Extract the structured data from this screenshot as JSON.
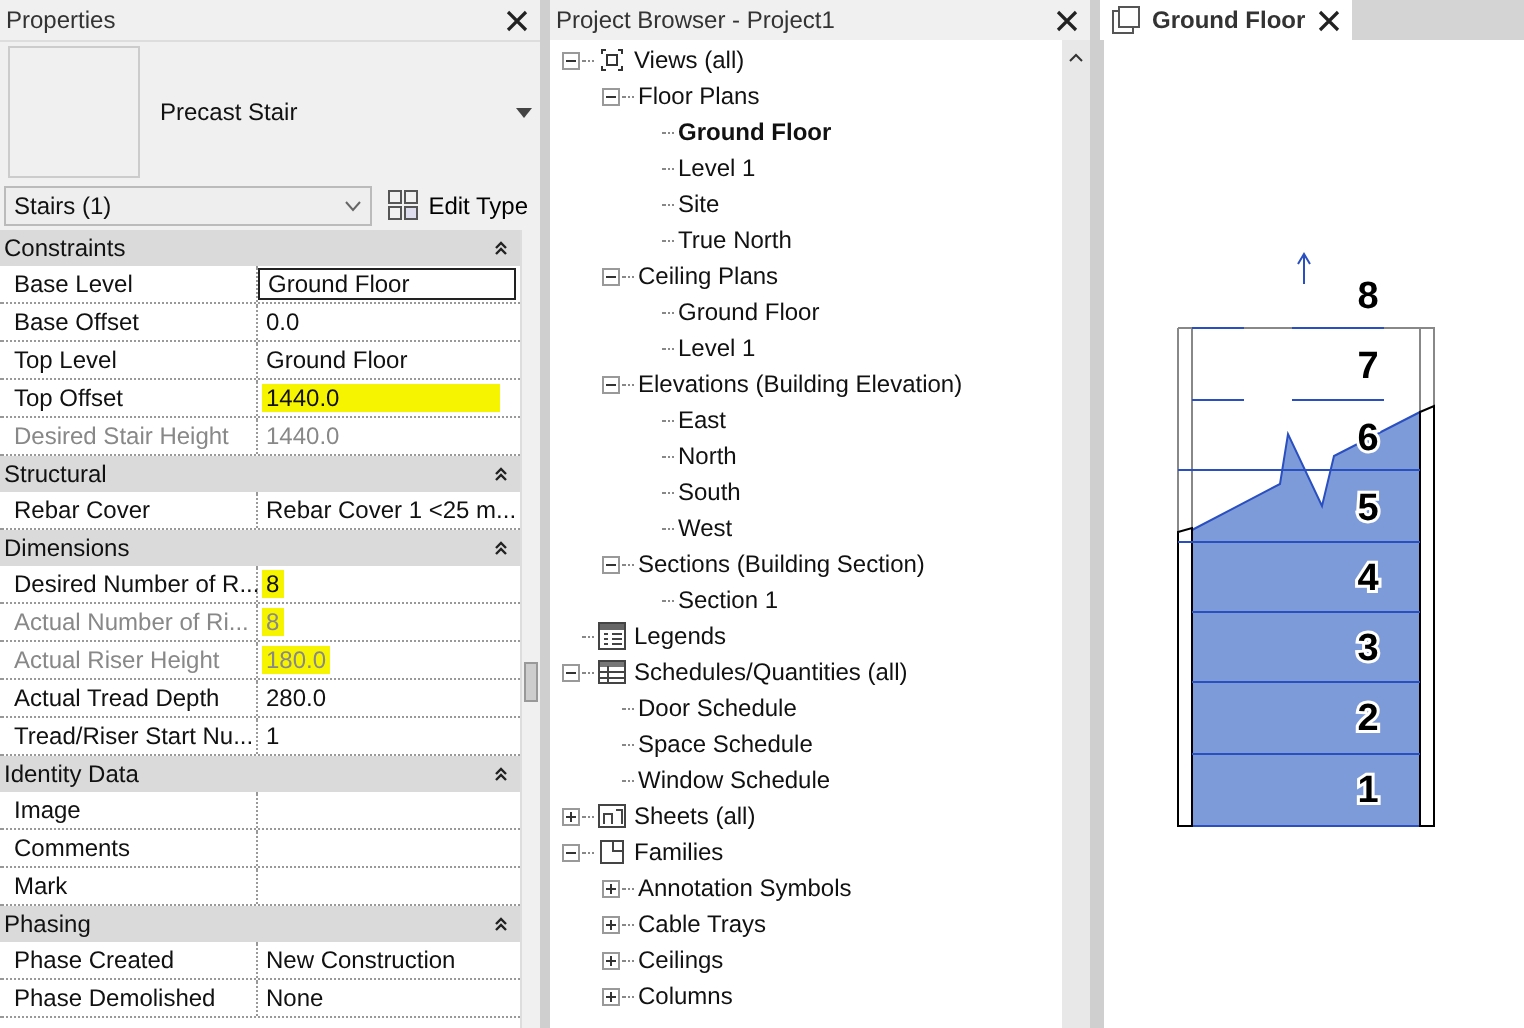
{
  "properties": {
    "title": "Properties",
    "type_name": "Precast Stair",
    "instance_selector": "Stairs (1)",
    "edit_type_button": "Edit Type",
    "groups": [
      {
        "name": "Constraints",
        "expanded": true,
        "rows": [
          {
            "label": "Base Level",
            "value": "Ground Floor",
            "disabled": false,
            "selected": true
          },
          {
            "label": "Base Offset",
            "value": "0.0",
            "disabled": false,
            "selected": false
          },
          {
            "label": "Top Level",
            "value": "Ground Floor",
            "disabled": false,
            "selected": false
          },
          {
            "label": "Top Offset",
            "value": "1440.0",
            "disabled": false,
            "highlighted": true,
            "selected": false
          },
          {
            "label": "Desired Stair Height",
            "value": "1440.0",
            "disabled": true,
            "selected": false
          }
        ]
      },
      {
        "name": "Structural",
        "expanded": true,
        "rows": [
          {
            "label": "Rebar Cover",
            "value": "Rebar Cover 1 <25 m...",
            "disabled": false,
            "selected": false
          }
        ]
      },
      {
        "name": "Dimensions",
        "expanded": true,
        "rows": [
          {
            "label": "Desired Number of R...",
            "value": "8",
            "disabled": false,
            "highlighted": true,
            "selected": false
          },
          {
            "label": "Actual Number of Ri...",
            "value": "8",
            "disabled": true,
            "highlighted": true,
            "selected": false
          },
          {
            "label": "Actual Riser Height",
            "value": "180.0",
            "disabled": true,
            "highlighted": true,
            "selected": false
          },
          {
            "label": "Actual Tread Depth",
            "value": "280.0",
            "disabled": false,
            "selected": false
          },
          {
            "label": "Tread/Riser Start Nu...",
            "value": "1",
            "disabled": false,
            "selected": false
          }
        ]
      },
      {
        "name": "Identity Data",
        "expanded": true,
        "rows": [
          {
            "label": "Image",
            "disabled": false,
            "selected": false
          },
          {
            "label": "Comments",
            "disabled": false,
            "selected": false
          },
          {
            "label": "Mark",
            "disabled": false,
            "selected": false
          }
        ]
      },
      {
        "name": "Phasing",
        "expanded": true,
        "rows": [
          {
            "label": "Phase Created",
            "value": "New Construction",
            "disabled": false,
            "selected": false
          },
          {
            "label": "Phase Demolished",
            "value": "None",
            "disabled": false,
            "selected": false
          }
        ]
      }
    ]
  },
  "project_browser": {
    "title": "Project Browser - Project1",
    "tree": [
      {
        "label": "Views (all)",
        "kind": "views",
        "expanded": true,
        "children": [
          {
            "label": "Floor Plans",
            "expanded": true,
            "children": [
              {
                "label": "Ground Floor",
                "active": true
              },
              {
                "label": "Level 1",
                "active": false
              },
              {
                "label": "Site",
                "active": false
              },
              {
                "label": "True North",
                "active": false
              }
            ]
          },
          {
            "label": "Ceiling Plans",
            "expanded": true,
            "children": [
              {
                "label": "Ground Floor",
                "active": false
              },
              {
                "label": "Level 1",
                "active": false
              }
            ]
          },
          {
            "label": "Elevations (Building Elevation)",
            "expanded": true,
            "children": [
              {
                "label": "East",
                "active": false
              },
              {
                "label": "North",
                "active": false
              },
              {
                "label": "South",
                "active": false
              },
              {
                "label": "West",
                "active": false
              }
            ]
          },
          {
            "label": "Sections (Building Section)",
            "expanded": true,
            "children": [
              {
                "label": "Section 1",
                "active": false
              }
            ]
          }
        ]
      },
      {
        "label": "Legends",
        "kind": "legends"
      },
      {
        "label": "Schedules/Quantities (all)",
        "kind": "schedules",
        "expanded": true,
        "children": [
          {
            "label": "Door Schedule"
          },
          {
            "label": "Space Schedule"
          },
          {
            "label": "Window Schedule"
          }
        ]
      },
      {
        "label": "Sheets (all)",
        "kind": "sheets",
        "expanded": false
      },
      {
        "label": "Families",
        "kind": "families",
        "expanded": true,
        "children": [
          {
            "label": "Annotation Symbols",
            "expanded": false
          },
          {
            "label": "Cable Trays",
            "expanded": false
          },
          {
            "label": "Ceilings",
            "expanded": false
          },
          {
            "label": "Columns",
            "expanded": false
          }
        ]
      }
    ]
  },
  "view": {
    "tab": "Ground Floor",
    "riser_numbers": [
      "8",
      "7",
      "6",
      "5",
      "4",
      "3",
      "2",
      "1"
    ]
  }
}
